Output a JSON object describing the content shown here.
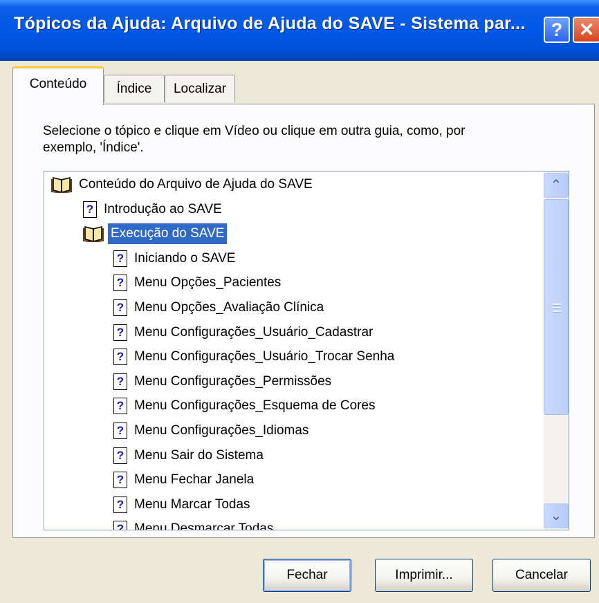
{
  "window": {
    "title": "Tópicos da Ajuda: Arquivo de Ajuda do SAVE - Sistema par...",
    "help_glyph": "?",
    "close_glyph": "✕"
  },
  "tabs": [
    {
      "label": "Conteúdo",
      "active": true
    },
    {
      "label": "Índice",
      "active": false
    },
    {
      "label": "Localizar",
      "active": false
    }
  ],
  "instructions": "Selecione o tópico e clique em Vídeo ou clique em outra guia, como, por exemplo, 'Índice'.",
  "tree": {
    "items": [
      {
        "label": "Conteúdo do Arquivo de Ajuda do SAVE",
        "icon": "open-book-icon",
        "level": 0
      },
      {
        "label": "Introdução ao SAVE",
        "icon": "help-topic-icon",
        "level": 1
      },
      {
        "label": "Execução do SAVE",
        "icon": "open-book-icon",
        "level": 1,
        "selected": true
      },
      {
        "label": "Iniciando o SAVE",
        "icon": "help-topic-icon",
        "level": 2
      },
      {
        "label": "Menu Opções_Pacientes",
        "icon": "help-topic-icon",
        "level": 2
      },
      {
        "label": "Menu Opções_Avaliação Clínica",
        "icon": "help-topic-icon",
        "level": 2
      },
      {
        "label": "Menu Configurações_Usuário_Cadastrar",
        "icon": "help-topic-icon",
        "level": 2
      },
      {
        "label": "Menu Configurações_Usuário_Trocar Senha",
        "icon": "help-topic-icon",
        "level": 2
      },
      {
        "label": "Menu Configurações_Permissões",
        "icon": "help-topic-icon",
        "level": 2
      },
      {
        "label": "Menu Configurações_Esquema de Cores",
        "icon": "help-topic-icon",
        "level": 2
      },
      {
        "label": "Menu Configurações_Idiomas",
        "icon": "help-topic-icon",
        "level": 2
      },
      {
        "label": "Menu Sair do Sistema",
        "icon": "help-topic-icon",
        "level": 2
      },
      {
        "label": "Menu Fechar Janela",
        "icon": "help-topic-icon",
        "level": 2
      },
      {
        "label": "Menu Marcar Todas",
        "icon": "help-topic-icon",
        "level": 2
      },
      {
        "label": "Menu Desmarcar Todas",
        "icon": "help-topic-icon",
        "level": 2
      }
    ],
    "help_glyph": "?"
  },
  "scrollbar": {
    "up_glyph": "⌃",
    "down_glyph": "⌄"
  },
  "buttons": {
    "close": "Fechar",
    "print": "Imprimir...",
    "cancel": "Cancelar"
  },
  "colors": {
    "titlebar": "#0058e6",
    "selection": "#316ac5",
    "tab_highlight": "#ffc83c"
  }
}
